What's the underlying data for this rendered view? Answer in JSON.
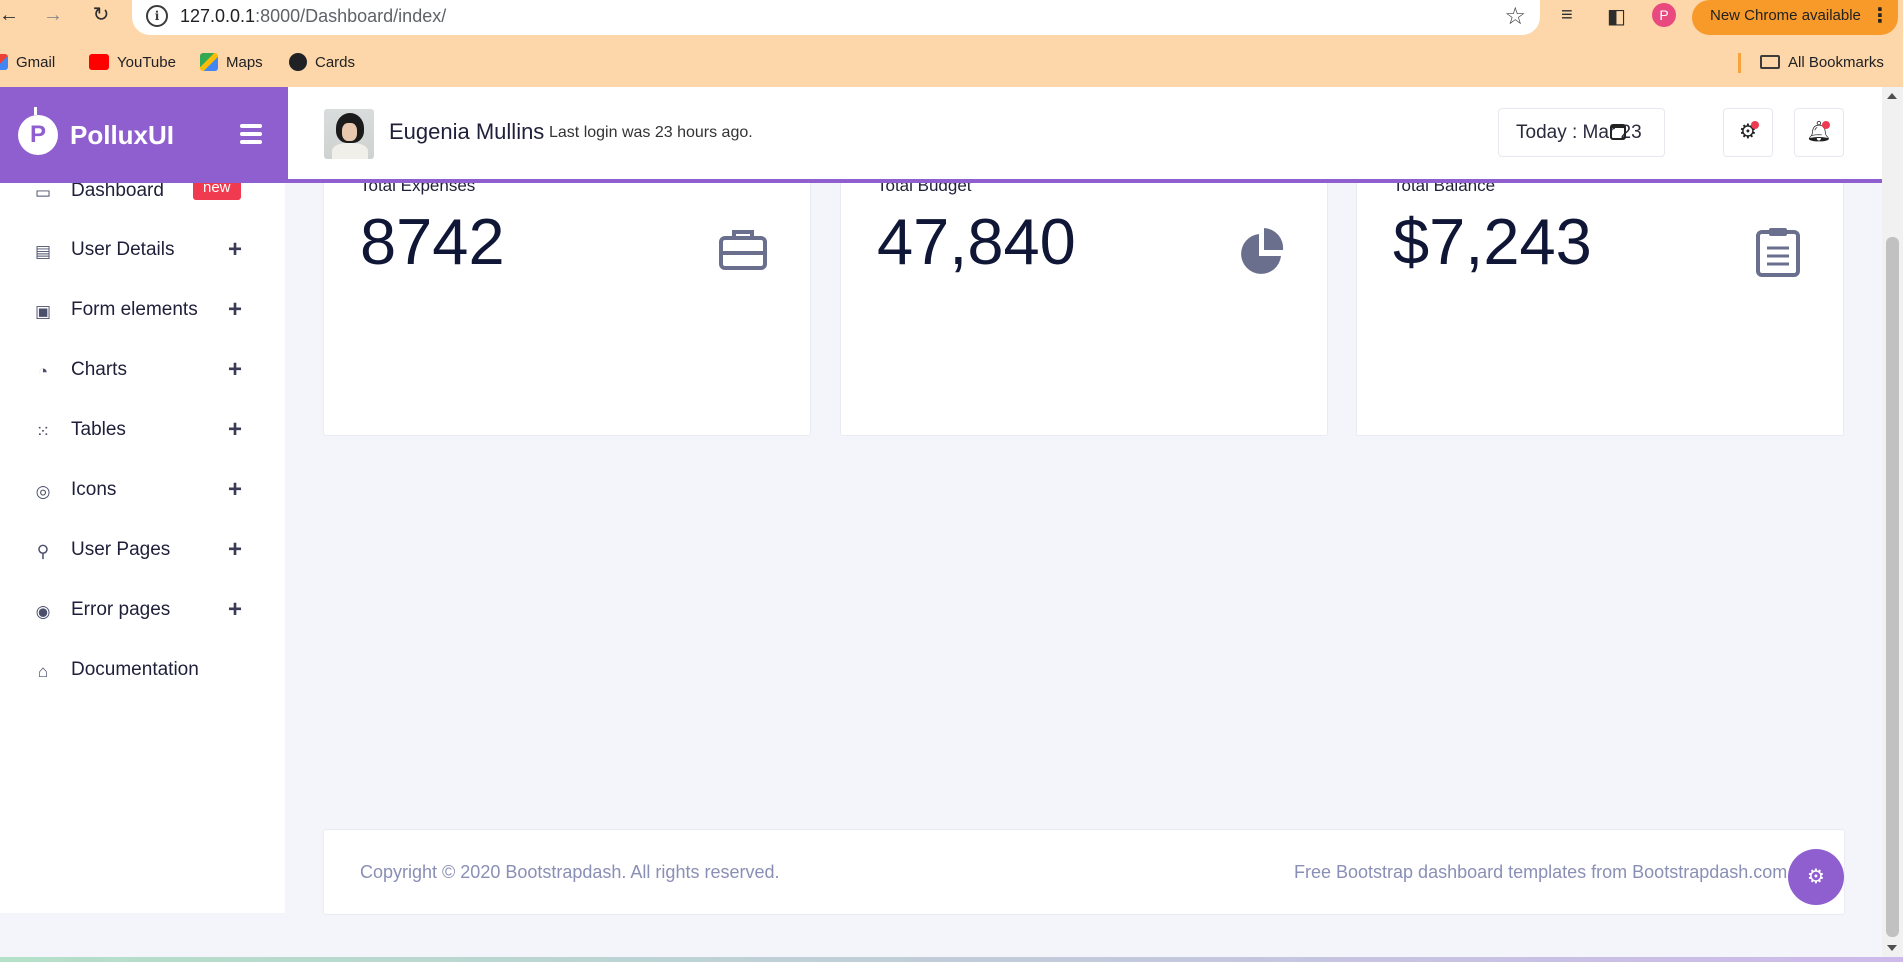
{
  "browser": {
    "url_host": "127.0.0.1",
    "url_path": ":8000/Dashboard/index/",
    "profile_initial": "P",
    "update_label": "New Chrome available",
    "bookmarks": [
      {
        "label": "Gmail",
        "icon": "gmail-icon",
        "color": "#ea4335"
      },
      {
        "label": "YouTube",
        "icon": "youtube-icon",
        "color": "#ff0000"
      },
      {
        "label": "Maps",
        "icon": "maps-icon",
        "color": "#34a853"
      },
      {
        "label": "Cards",
        "icon": "globe-icon",
        "color": "#202124"
      }
    ],
    "all_bookmarks_label": "All Bookmarks"
  },
  "brand": {
    "name": "PolluxUI",
    "logo_letter": "P",
    "accent": "#8f5fd0"
  },
  "header": {
    "user_name": "Eugenia Mullins",
    "last_login": "Last login was 23 hours ago.",
    "today_label": "Today : Mar 23"
  },
  "sidebar": {
    "items": [
      {
        "label": "Dashboard",
        "icon": "monitor-icon",
        "badge": "new"
      },
      {
        "label": "User Details",
        "icon": "document-icon"
      },
      {
        "label": "Form elements",
        "icon": "form-icon"
      },
      {
        "label": "Charts",
        "icon": "pie-chart-icon"
      },
      {
        "label": "Tables",
        "icon": "grid-icon"
      },
      {
        "label": "Icons",
        "icon": "compass-icon"
      },
      {
        "label": "User Pages",
        "icon": "user-plus-icon"
      },
      {
        "label": "Error pages",
        "icon": "globe-icon"
      },
      {
        "label": "Documentation",
        "icon": "graduation-cap-icon"
      }
    ]
  },
  "cards": [
    {
      "title": "Total Expenses",
      "value": "8742",
      "icon": "briefcase-icon"
    },
    {
      "title": "Total Budget",
      "value": "47,840",
      "icon": "pie-chart-icon"
    },
    {
      "title": "Total Balance",
      "value": "$7,243",
      "icon": "clipboard-icon"
    }
  ],
  "footer": {
    "copyright": "Copyright © 2020 Bootstrapdash. All rights reserved.",
    "free_templates": "Free Bootstrap dashboard templates from Bootstrapdash.com"
  }
}
